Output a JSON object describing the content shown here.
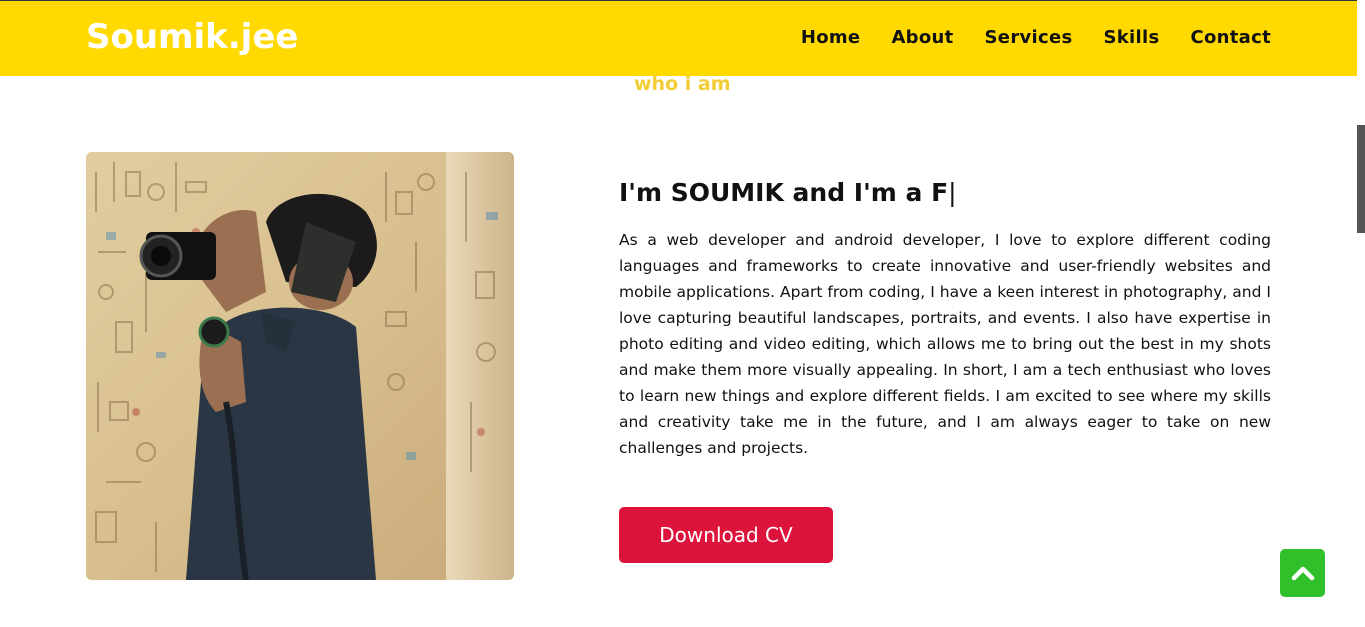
{
  "brand": {
    "logo": "Soumik.jee"
  },
  "nav": {
    "items": [
      {
        "label": "Home"
      },
      {
        "label": "About"
      },
      {
        "label": "Services"
      },
      {
        "label": "Skills"
      },
      {
        "label": "Contact"
      }
    ]
  },
  "about": {
    "subtitle": "who i am",
    "headline": "I'm SOUMIK and I'm a F",
    "caret": "|",
    "bio": "As a web developer and android developer, I love to explore different coding languages and frameworks to create innovative and user-friendly websites and mobile applications. Apart from coding, I have a keen interest in photography, and I love capturing beautiful landscapes, portraits, and events. I also have expertise in photo editing and video editing, which allows me to bring out the best in my shots and make them more visually appealing. In short, I am a tech enthusiast who loves to learn new things and explore different fields. I am excited to see where my skills and creativity take me in the future, and I am always eager to take on new challenges and projects.",
    "cta_label": "Download CV"
  },
  "colors": {
    "navbar": "#ffd900",
    "subtitle": "#f2cd35",
    "cta": "#dc143c",
    "scroll_top": "#2fc02a"
  },
  "icons": {
    "scroll_top": "chevron-up-icon",
    "photo": "profile-photo"
  }
}
